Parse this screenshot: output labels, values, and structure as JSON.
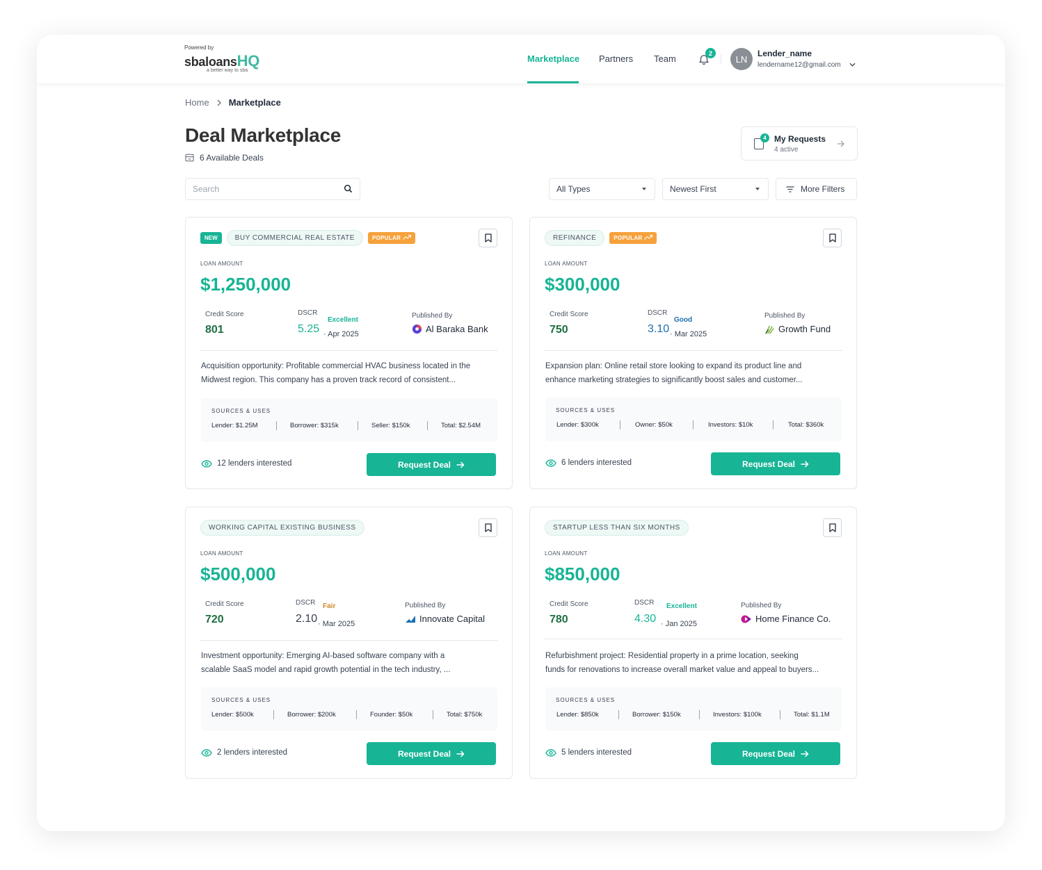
{
  "header": {
    "powered_by": "Powered by",
    "brand_main": "sbaloans",
    "brand_hq": "HQ",
    "tagline": "a better way to sba",
    "nav": [
      {
        "label": "Marketplace",
        "active": true
      },
      {
        "label": "Partners",
        "active": false
      },
      {
        "label": "Team",
        "active": false
      }
    ],
    "notification_count": "2",
    "avatar_initials": "LN",
    "user_name": "Lender_name",
    "user_email": "lendername12@gmail.com"
  },
  "breadcrumb": {
    "home": "Home",
    "current": "Marketplace"
  },
  "page": {
    "title": "Deal Marketplace",
    "available": "6 Available Deals",
    "my_requests": {
      "label": "My Requests",
      "sub": "4 active",
      "badge": "4"
    }
  },
  "filters": {
    "search_placeholder": "Search",
    "type": "All Types",
    "sort": "Newest First",
    "more": "More Filters"
  },
  "labels": {
    "loan_amount": "LOAN AMOUNT",
    "credit_score": "Credit Score",
    "dscr": "DSCR",
    "published_by": "Published By",
    "sources_uses": "SOURCES & USES",
    "request_deal": "Request Deal",
    "new": "NEW",
    "popular": "POPULAR"
  },
  "colors": {
    "accent": "#17b495",
    "popular": "#f6a13b",
    "credit": "#1f6f43"
  },
  "deals": [
    {
      "is_new": true,
      "type": "BUY COMMERCIAL REAL ESTATE",
      "popular": true,
      "amount": "$1,250,000",
      "credit_score": "801",
      "dscr": "5.25",
      "rating": "Excellent",
      "rating_color": "#17b495",
      "dscr_color": "#17b495",
      "date": "· Apr 2025",
      "publisher": "Al Baraka Bank",
      "publisher_icon": "al-baraka-logo",
      "description_1": "Acquisition opportunity: Profitable commercial HVAC business located in the",
      "description_2": "Midwest region. This company has a proven track record of consistent...",
      "sources": [
        "Lender: $1.25M",
        "Borrower: $315k",
        "Seller: $150k",
        "Total: $2.54M"
      ],
      "interested": "12 lenders interested"
    },
    {
      "is_new": false,
      "type": "REFINANCE",
      "popular": true,
      "amount": "$300,000",
      "credit_score": "750",
      "dscr": "3.10",
      "rating": "Good",
      "rating_color": "#1a6fb0",
      "dscr_color": "#1a6fb0",
      "date": "· Mar 2025",
      "publisher": "Growth Fund",
      "publisher_icon": "growth-fund-logo",
      "description_1": "Expansion plan: Online retail store looking to expand its product line and",
      "description_2": "enhance marketing strategies to significantly boost sales and customer...",
      "sources": [
        "Lender: $300k",
        "Owner: $50k",
        "Investors: $10k",
        "Total: $360k"
      ],
      "interested": "6 lenders interested"
    },
    {
      "is_new": false,
      "type": "WORKING CAPITAL EXISTING BUSINESS",
      "popular": false,
      "amount": "$500,000",
      "credit_score": "720",
      "dscr": "2.10",
      "rating": "Fair",
      "rating_color": "#d08a2a",
      "dscr_color": "#374151",
      "date": "· Mar 2025",
      "publisher": "Innovate Capital",
      "publisher_icon": "innovate-capital-logo",
      "description_1": "Investment opportunity: Emerging AI-based software company with a",
      "description_2": "scalable SaaS model and rapid growth potential in the tech industry, ...",
      "sources": [
        "Lender: $500k",
        "Borrower: $200k",
        "Founder: $50k",
        "Total: $750k"
      ],
      "interested": "2 lenders interested"
    },
    {
      "is_new": false,
      "type": "STARTUP LESS THAN SIX MONTHS",
      "popular": false,
      "amount": "$850,000",
      "credit_score": "780",
      "dscr": "4.30",
      "rating": "Excellent",
      "rating_color": "#17b495",
      "dscr_color": "#17b495",
      "date": "· Jan 2025",
      "publisher": "Home Finance Co.",
      "publisher_icon": "home-finance-logo",
      "description_1": "Refurbishment project: Residential property in a prime location, seeking",
      "description_2": "funds for renovations to increase overall market value and appeal to buyers...",
      "sources": [
        "Lender: $850k",
        "Borrower: $150k",
        "Investors: $100k",
        "Total: $1.1M"
      ],
      "interested": "5 lenders interested"
    }
  ]
}
